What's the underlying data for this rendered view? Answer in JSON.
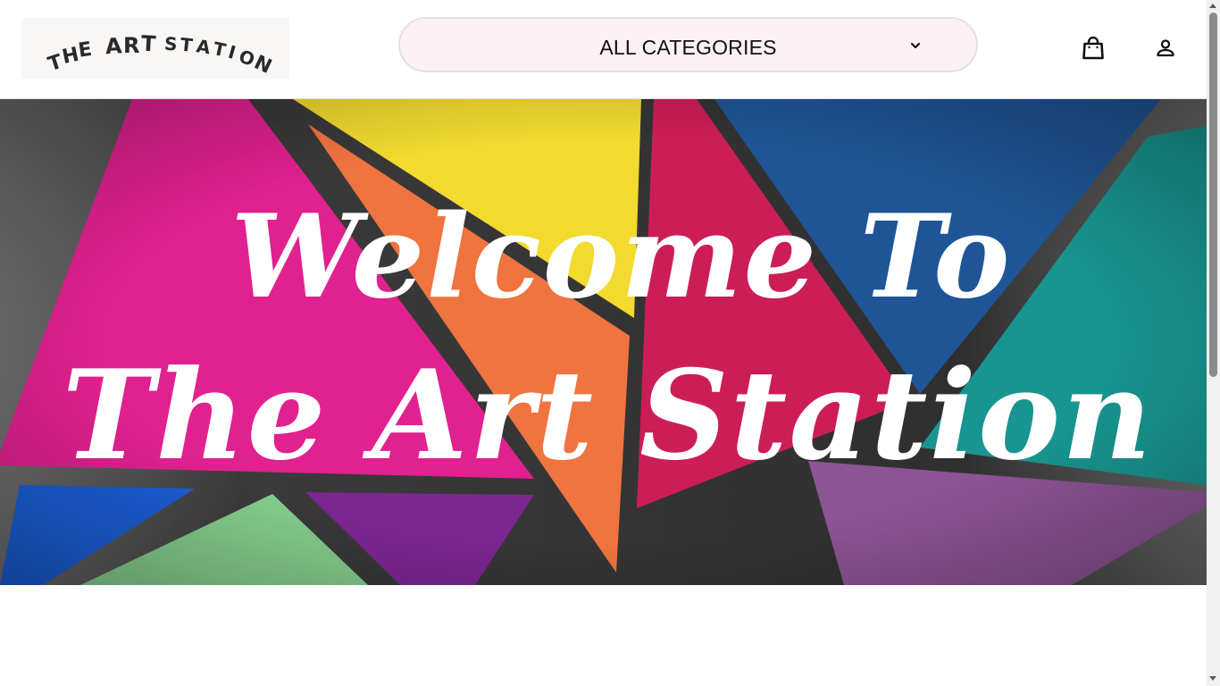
{
  "brand": {
    "logo_text": "THE ART STATION",
    "logo_icon": "art-station-wordmark"
  },
  "nav": {
    "category_select": {
      "selected": "ALL CATEGORIES",
      "icon": "chevron-down-icon"
    },
    "cart_icon": "shopping-bag-icon",
    "account_icon": "user-icon"
  },
  "hero": {
    "line1": "Welcome To",
    "line2": "The Art Station",
    "colors": [
      "#e0218f",
      "#f2da2f",
      "#f07440",
      "#cc1e56",
      "#1f5596",
      "#189590",
      "#1b5fd8",
      "#84cd8c",
      "#7b2691",
      "#8d5495"
    ]
  },
  "theme": {
    "select_background": "#fdf0f5",
    "select_border": "#e3e1e1",
    "text_color": "#111111"
  }
}
